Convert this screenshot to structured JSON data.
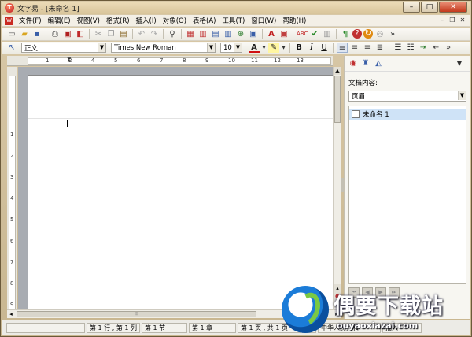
{
  "window": {
    "title": "文字易 - [未命名 1]",
    "app_icon": "T",
    "minimize": "–",
    "maximize": "□",
    "close": "✕"
  },
  "menubar": {
    "items": [
      "文件(F)",
      "编辑(E)",
      "视图(V)",
      "格式(R)",
      "插入(I)",
      "对象(O)",
      "表格(A)",
      "工具(T)",
      "窗口(W)",
      "帮助(H)"
    ],
    "doc_minimize": "–",
    "doc_restore": "❐",
    "doc_close": "✕"
  },
  "format_bar": {
    "style_value": "正文",
    "font_value": "Times New Roman",
    "size_value": "10",
    "font_color_letter": "A",
    "bold": "B",
    "italic": "I",
    "underline": "U"
  },
  "ruler": {
    "labels": [
      "1",
      "2",
      "4",
      "5",
      "6",
      "7",
      "8",
      "9",
      "10",
      "11",
      "12",
      "13"
    ]
  },
  "vruler": {
    "labels": [
      "1",
      "2",
      "3",
      "4",
      "5",
      "6",
      "7",
      "8",
      "9"
    ]
  },
  "panel": {
    "content_label": "文档内容:",
    "dropdown_value": "页眉",
    "tree_items": [
      "未命名 1"
    ]
  },
  "status": {
    "cells": [
      "第 1 行 , 第 1 列",
      "第 1 节",
      "第 1 章",
      "第 1 页 , 共 1 页",
      "中",
      "中华人民共和",
      "插入"
    ]
  },
  "watermark": {
    "cn": "偶要下载站",
    "en": "ouyaoxiazai.com"
  },
  "colors": {
    "accent_red": "#c0141a",
    "selection_blue": "#cfe3f7",
    "chrome_tan": "#d8c49a"
  }
}
